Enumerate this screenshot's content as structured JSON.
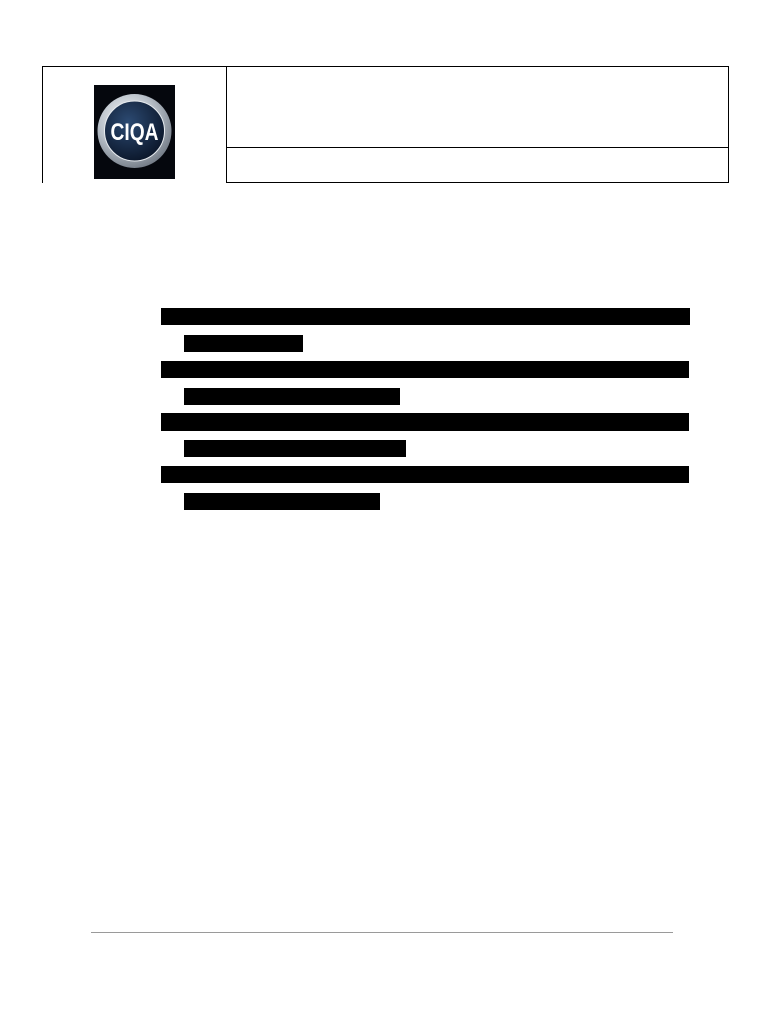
{
  "logo": {
    "text": "CIQA",
    "ring_color": "#c9cfd6",
    "inner_color": "#12233d",
    "background_color": "#05070d"
  },
  "redaction_color": "#000000",
  "footer_rule_color": "#9a9a9a"
}
